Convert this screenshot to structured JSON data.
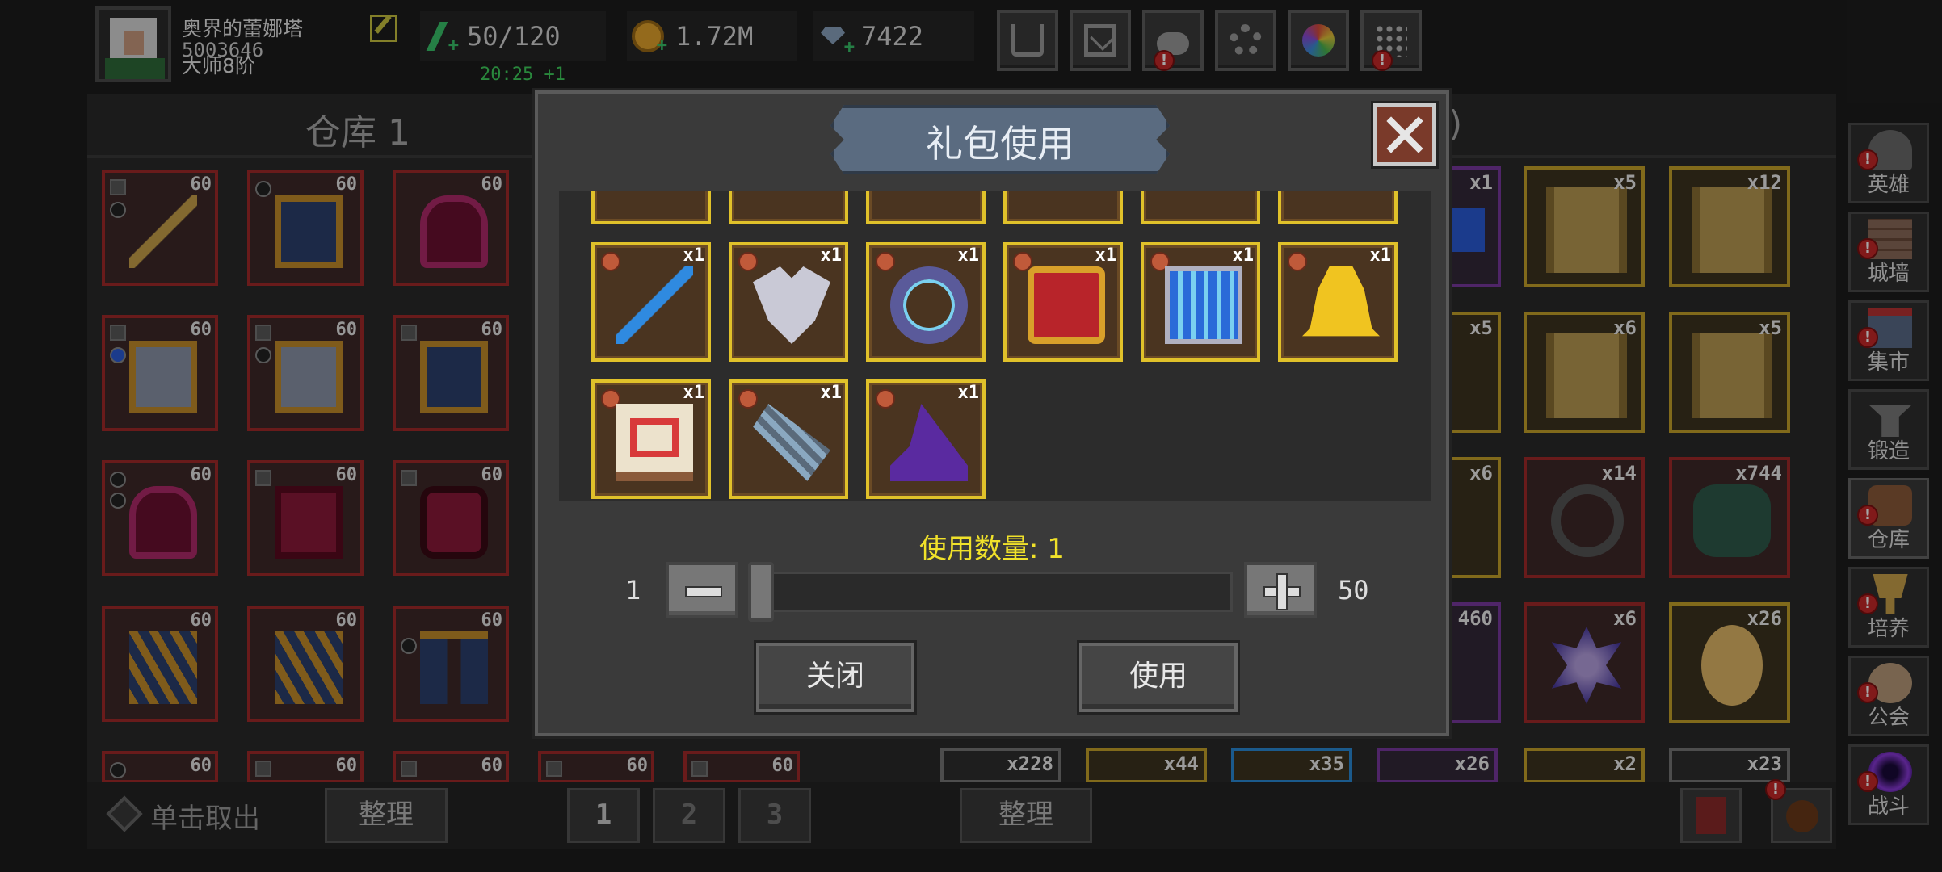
{
  "player": {
    "name": "奥界的蕾娜塔",
    "id": "5003646",
    "rank": "大师8阶"
  },
  "resources": {
    "energy": "50/120",
    "gold": "1.72M",
    "gems": "7422",
    "energy_timer": "20:25 +1"
  },
  "toolbar": [
    "cart-icon",
    "mail-icon",
    "gamepad-icon",
    "gear-icon",
    "shutter-icon",
    "firework-icon"
  ],
  "tabs": {
    "left": "仓库 1",
    "right": ")"
  },
  "left_slots": [
    {
      "level": "60"
    },
    {
      "level": "60"
    },
    {
      "level": "60"
    },
    {
      "level": "60"
    },
    {
      "level": "60"
    },
    {
      "level": "60"
    },
    {
      "level": "60"
    },
    {
      "level": "60"
    },
    {
      "level": "60"
    },
    {
      "level": "60"
    },
    {
      "level": "60"
    },
    {
      "level": "60"
    },
    {
      "level": "60"
    },
    {
      "level": "60"
    },
    {
      "level": "60"
    },
    {
      "level": "60"
    },
    {
      "level": "60"
    }
  ],
  "right_slots": [
    {
      "count": "x1"
    },
    {
      "count": "x5"
    },
    {
      "count": "x12"
    },
    {
      "count": "x5"
    },
    {
      "count": "x6"
    },
    {
      "count": "x5"
    },
    {
      "count": "x6"
    },
    {
      "count": "x14"
    },
    {
      "count": "x744"
    },
    {
      "count": "460"
    },
    {
      "count": "x6"
    },
    {
      "count": "x26"
    },
    {
      "count": "x228"
    },
    {
      "count": "x44"
    },
    {
      "count": "x35"
    },
    {
      "count": "x26"
    },
    {
      "count": "x2"
    },
    {
      "count": "x23"
    }
  ],
  "side_menu": [
    "英雄",
    "城墙",
    "集市",
    "锻造",
    "仓库",
    "培养",
    "公会",
    "战斗"
  ],
  "bottom": {
    "take_out": "单击取出",
    "sort": "整理",
    "pages": [
      "1",
      "2",
      "3"
    ]
  },
  "modal": {
    "title": "礼包使用",
    "items": [
      {
        "count": "x1",
        "name": "ice-staff"
      },
      {
        "count": "x1",
        "name": "winged-emblem"
      },
      {
        "count": "x1",
        "name": "frost-ring"
      },
      {
        "count": "x1",
        "name": "war-drum"
      },
      {
        "count": "x1",
        "name": "crystal-lantern"
      },
      {
        "count": "x1",
        "name": "golden-bell"
      },
      {
        "count": "x1",
        "name": "spell-book"
      },
      {
        "count": "x1",
        "name": "quiver"
      },
      {
        "count": "x1",
        "name": "wizard-hat"
      }
    ],
    "quantity_label": "使用数量: 1",
    "min": "1",
    "max": "50",
    "close_label": "关闭",
    "use_label": "使用"
  }
}
